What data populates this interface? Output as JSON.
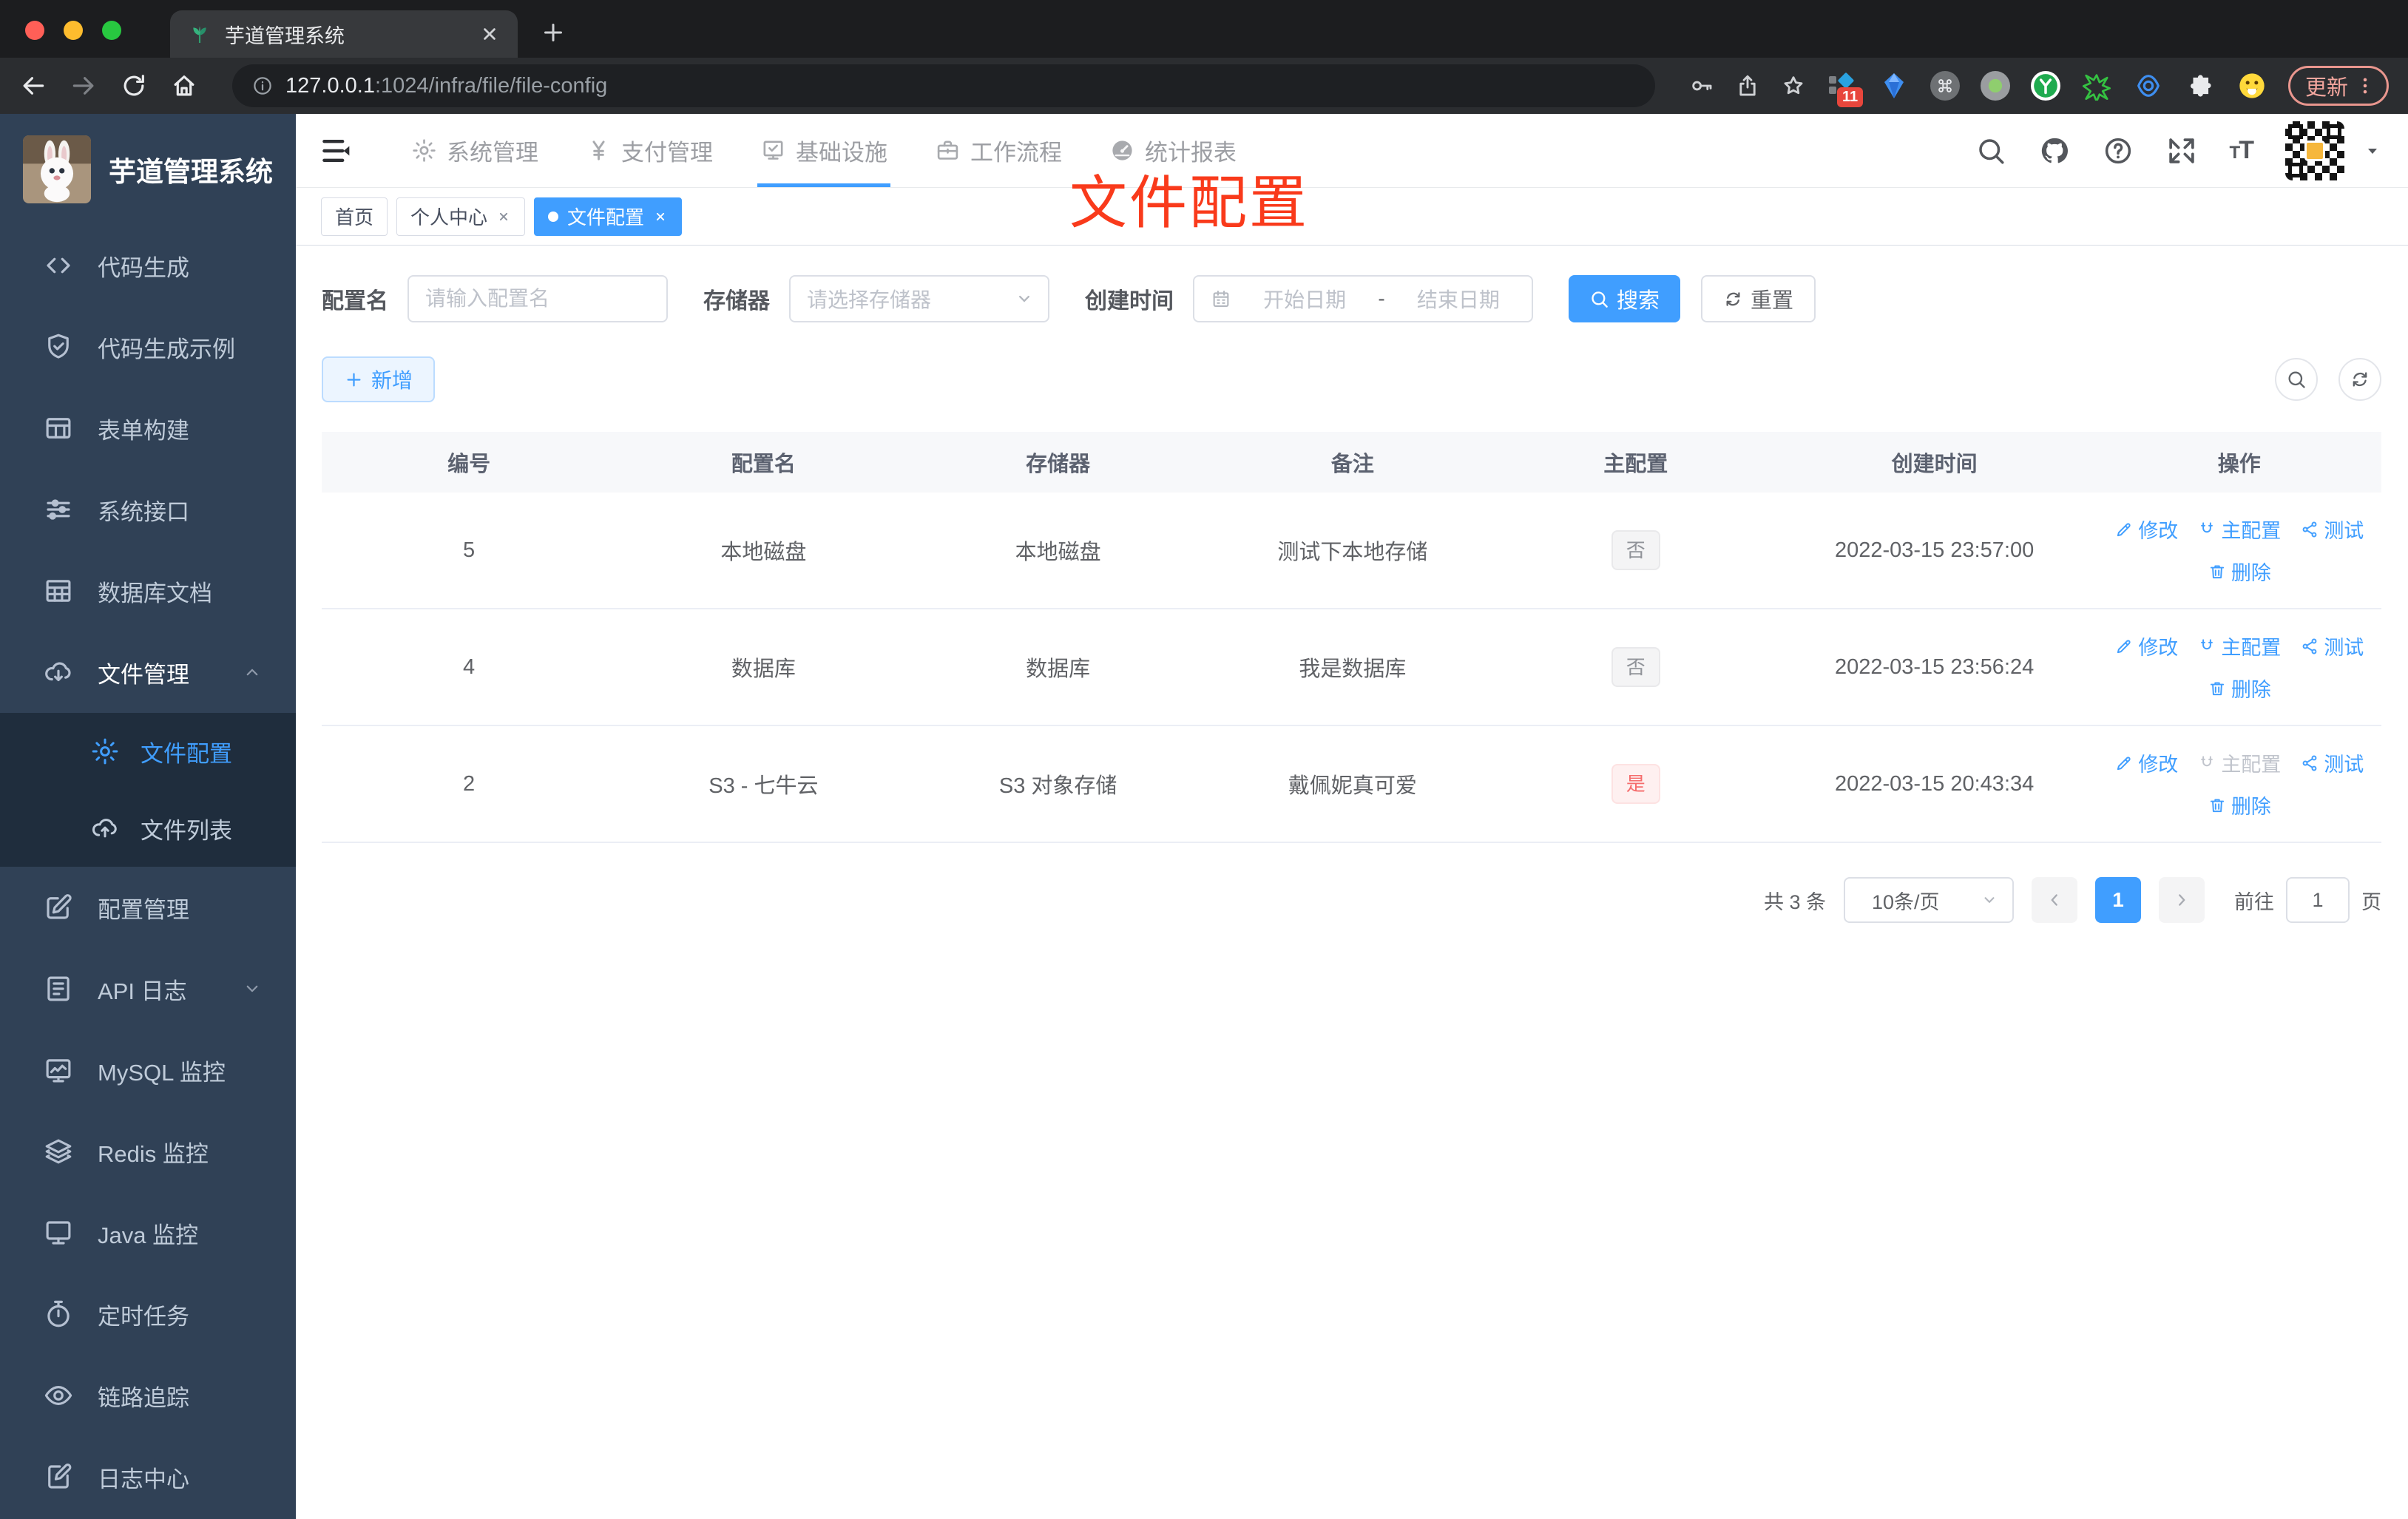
{
  "browser": {
    "tab_title": "芋道管理系统",
    "url_host": "127.0.0.1",
    "url_rest": ":1024/infra/file/file-config",
    "ext_badge": "11",
    "update_label": "更新"
  },
  "sidebar": {
    "logo_title": "芋道管理系统",
    "items": [
      {
        "key": "code-gen",
        "label": "代码生成",
        "icon": "code"
      },
      {
        "key": "code-gen-demo",
        "label": "代码生成示例",
        "icon": "shield-check"
      },
      {
        "key": "form-builder",
        "label": "表单构建",
        "icon": "form-grid"
      },
      {
        "key": "system-api",
        "label": "系统接口",
        "icon": "sliders"
      },
      {
        "key": "db-doc",
        "label": "数据库文档",
        "icon": "table"
      },
      {
        "key": "file-manage",
        "label": "文件管理",
        "icon": "cloud-download",
        "expanded": true,
        "children": [
          {
            "key": "file-config",
            "label": "文件配置",
            "icon": "gear",
            "active": true
          },
          {
            "key": "file-list",
            "label": "文件列表",
            "icon": "cloud-upload"
          }
        ]
      },
      {
        "key": "config-manage",
        "label": "配置管理",
        "icon": "edit-square"
      },
      {
        "key": "api-log",
        "label": "API 日志",
        "icon": "document",
        "collapsible": true
      },
      {
        "key": "mysql-monitor",
        "label": "MySQL 监控",
        "icon": "chart-monitor"
      },
      {
        "key": "redis-monitor",
        "label": "Redis 监控",
        "icon": "layers"
      },
      {
        "key": "java-monitor",
        "label": "Java 监控",
        "icon": "display"
      },
      {
        "key": "cron-job",
        "label": "定时任务",
        "icon": "timer"
      },
      {
        "key": "trace",
        "label": "链路追踪",
        "icon": "eye"
      },
      {
        "key": "log-center",
        "label": "日志中心",
        "icon": "log"
      }
    ]
  },
  "topnav": {
    "items": [
      {
        "key": "system",
        "label": "系统管理",
        "icon": "gear"
      },
      {
        "key": "pay",
        "label": "支付管理",
        "icon": "yen"
      },
      {
        "key": "infra",
        "label": "基础设施",
        "icon": "board-check",
        "active": true
      },
      {
        "key": "workflow",
        "label": "工作流程",
        "icon": "briefcase"
      },
      {
        "key": "report",
        "label": "统计报表",
        "icon": "gauge"
      }
    ]
  },
  "tags": [
    {
      "key": "home",
      "label": "首页"
    },
    {
      "key": "profile",
      "label": "个人中心",
      "closable": true
    },
    {
      "key": "file-config",
      "label": "文件配置",
      "closable": true,
      "active": true
    }
  ],
  "annotation": {
    "text": "文件配置",
    "color": "#f93a1b"
  },
  "filters": {
    "name_label": "配置名",
    "name_placeholder": "请输入配置名",
    "storage_label": "存储器",
    "storage_placeholder": "请选择存储器",
    "time_label": "创建时间",
    "start_placeholder": "开始日期",
    "range_separator": "-",
    "end_placeholder": "结束日期",
    "search_label": "搜索",
    "reset_label": "重置"
  },
  "toolbar": {
    "add_label": "新增"
  },
  "table": {
    "columns": [
      "编号",
      "配置名",
      "存储器",
      "备注",
      "主配置",
      "创建时间",
      "操作"
    ],
    "action_labels": {
      "edit": "修改",
      "master": "主配置",
      "test": "测试",
      "delete": "删除"
    },
    "rows": [
      {
        "id": "5",
        "name": "本地磁盘",
        "storage": "本地磁盘",
        "remark": "测试下本地存储",
        "master": "否",
        "master_type": "info",
        "created": "2022-03-15 23:57:00",
        "master_disabled": false
      },
      {
        "id": "4",
        "name": "数据库",
        "storage": "数据库",
        "remark": "我是数据库",
        "master": "否",
        "master_type": "info",
        "created": "2022-03-15 23:56:24",
        "master_disabled": false
      },
      {
        "id": "2",
        "name": "S3 - 七牛云",
        "storage": "S3 对象存储",
        "remark": "戴佩妮真可爱",
        "master": "是",
        "master_type": "danger",
        "created": "2022-03-15 20:43:34",
        "master_disabled": true
      }
    ]
  },
  "pagination": {
    "total_text": "共 3 条",
    "size_text": "10条/页",
    "current_page": "1",
    "goto_label": "前往",
    "goto_value": "1",
    "page_label": "页"
  },
  "colors": {
    "accent": "#409eff",
    "danger": "#f56c6c",
    "sidebar_bg": "#304156",
    "annotation": "#f93a1b"
  }
}
